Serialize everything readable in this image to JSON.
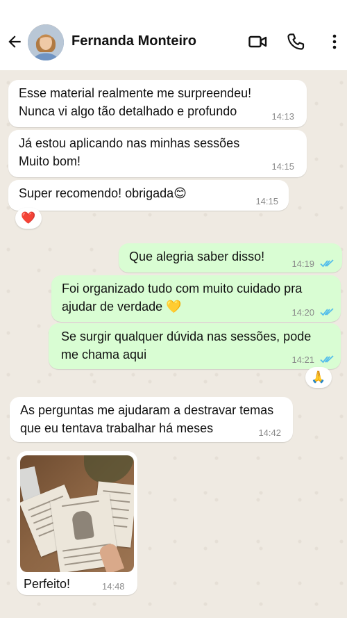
{
  "header": {
    "contact_name": "Fernanda Monteiro",
    "icons": [
      "back-arrow-icon",
      "video-call-icon",
      "phone-icon",
      "more-vert-icon"
    ]
  },
  "colors": {
    "incoming": "#ffffff",
    "outgoing": "#d9fdd3",
    "ticks": "#53bdeb",
    "background": "#efeae2"
  },
  "messages": [
    {
      "dir": "in",
      "lines": "Esse material realmente me surpreendeu!\nNunca vi algo tão detalhado e profundo",
      "time": "14:13"
    },
    {
      "dir": "in",
      "lines": "Já estou aplicando nas minhas sessões\nMuito bom!",
      "time": "14:15"
    },
    {
      "dir": "in",
      "lines": "Super recomendo! obrigada😊",
      "time": "14:15",
      "reaction": "❤️"
    },
    {
      "dir": "out",
      "lines": "Que alegria saber disso!",
      "time": "14:19",
      "read": true
    },
    {
      "dir": "out",
      "lines": "Foi organizado tudo com muito cuidado pra\najudar de verdade 💛",
      "time": "14:20",
      "read": true
    },
    {
      "dir": "out",
      "lines": "Se surgir qualquer dúvida nas sessões, pode\nme chama aqui",
      "time": "14:21",
      "read": true,
      "reaction": "🙏"
    },
    {
      "dir": "in",
      "lines": "As perguntas me ajudaram a destravar temas\nque eu tentava trabalhar há meses",
      "time": "14:42"
    },
    {
      "dir": "in",
      "type": "image",
      "caption": "Perfeito!",
      "time": "14:48"
    }
  ]
}
